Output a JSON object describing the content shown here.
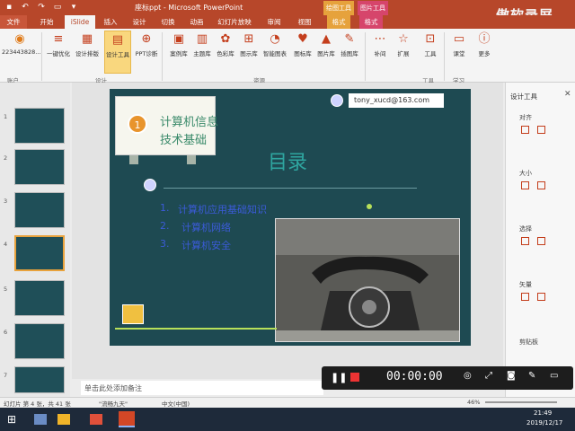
{
  "window": {
    "title": "座标ppt  -  Microsoft PowerPoint",
    "context_tab1": "绘图工具",
    "context_tab1_sub": "格式",
    "context_tab2": "图片工具",
    "context_tab2_sub": "格式",
    "watermark": "傲软录屏"
  },
  "tabs": [
    "文件",
    "开始",
    "iSlide",
    "插入",
    "设计",
    "切换",
    "动画",
    "幻灯片放映",
    "审阅",
    "视图",
    "格式",
    "格式"
  ],
  "ribbon": {
    "account": "223443828...",
    "account_group": "账户",
    "buttons": [
      "一键优化",
      "设计排版",
      "设计工具",
      "PPT诊断",
      "案例库",
      "主题库",
      "色彩库",
      "图示库",
      "智能图表",
      "图标库",
      "图片库",
      "插图库",
      "补间",
      "扩展",
      "工具",
      "课堂",
      "更多"
    ],
    "groups": [
      "设计",
      "资源",
      "工具",
      "学习"
    ]
  },
  "slides": [
    "1",
    "2",
    "3",
    "4",
    "5",
    "6",
    "7"
  ],
  "slide": {
    "email": "tony_xucd@163.com",
    "badge_number": "1",
    "card_title_line1": "计算机信息",
    "card_title_line2": "技术基础",
    "heading": "目录",
    "items": [
      "计算机应用基础知识",
      "计算机网络",
      "计算机安全"
    ],
    "item_nums": [
      "1.",
      "2.",
      "3."
    ]
  },
  "notes_placeholder": "单击此处添加备注",
  "right_pane": {
    "title": "设计工具",
    "sections": [
      "对齐",
      "大小",
      "选择",
      "矢量",
      "剪贴板"
    ]
  },
  "recorder": {
    "time": "00:00:00"
  },
  "status": {
    "slide_info": "幻灯片 第 4 张，共 41 张",
    "theme": "\"流畅九天\"",
    "language": "中文(中国)",
    "zoom": "46%"
  },
  "taskbar": {
    "time": "21:49",
    "date": "2019/12/17"
  },
  "colors": {
    "accent": "#b7472a",
    "slide_bg": "#1e4a52",
    "heading": "#2fa6a0",
    "item_text": "#3b5bd8"
  }
}
